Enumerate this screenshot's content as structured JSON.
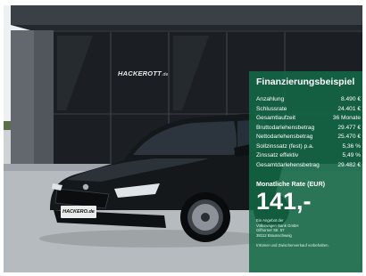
{
  "dealer": {
    "sign_text": "HACKEROTT",
    "sign_suffix": ".de",
    "plate_text": "HACKERO",
    "plate_suffix": ".de"
  },
  "financing": {
    "title": "Finanzierungsbeispiel",
    "rows": [
      {
        "label": "Anzahlung",
        "value": "8.490 €"
      },
      {
        "label": "Schlussrate",
        "value": "24.401 €"
      },
      {
        "label": "Gesamtlaufzeit",
        "value": "36 Monate"
      },
      {
        "label": "Bruttodarlehensbetrag",
        "value": "29.477 €"
      },
      {
        "label": "Nettodarlehensbetrag",
        "value": "25.470 €"
      },
      {
        "label": "Sollzinssatz (fest) p.a.",
        "value": "5,36 %"
      },
      {
        "label": "Zinssatz effektiv",
        "value": "5,49 %"
      },
      {
        "label": "Gesamtdarlehensbetrag",
        "value": "29.482 €"
      }
    ],
    "rate_label": "Monatliche Rate (EUR)",
    "rate_value": "141,-",
    "provider_lines": [
      "Ein Angebot der",
      "Volkswagen Bank GmbH",
      "Gifhorner Str. 57",
      "38112 Braunschweig"
    ],
    "disclaimer": "Irrtümer und Zwischenverkauf vorbehalten."
  },
  "colors": {
    "panel": "#146946",
    "car": "#14181b"
  }
}
